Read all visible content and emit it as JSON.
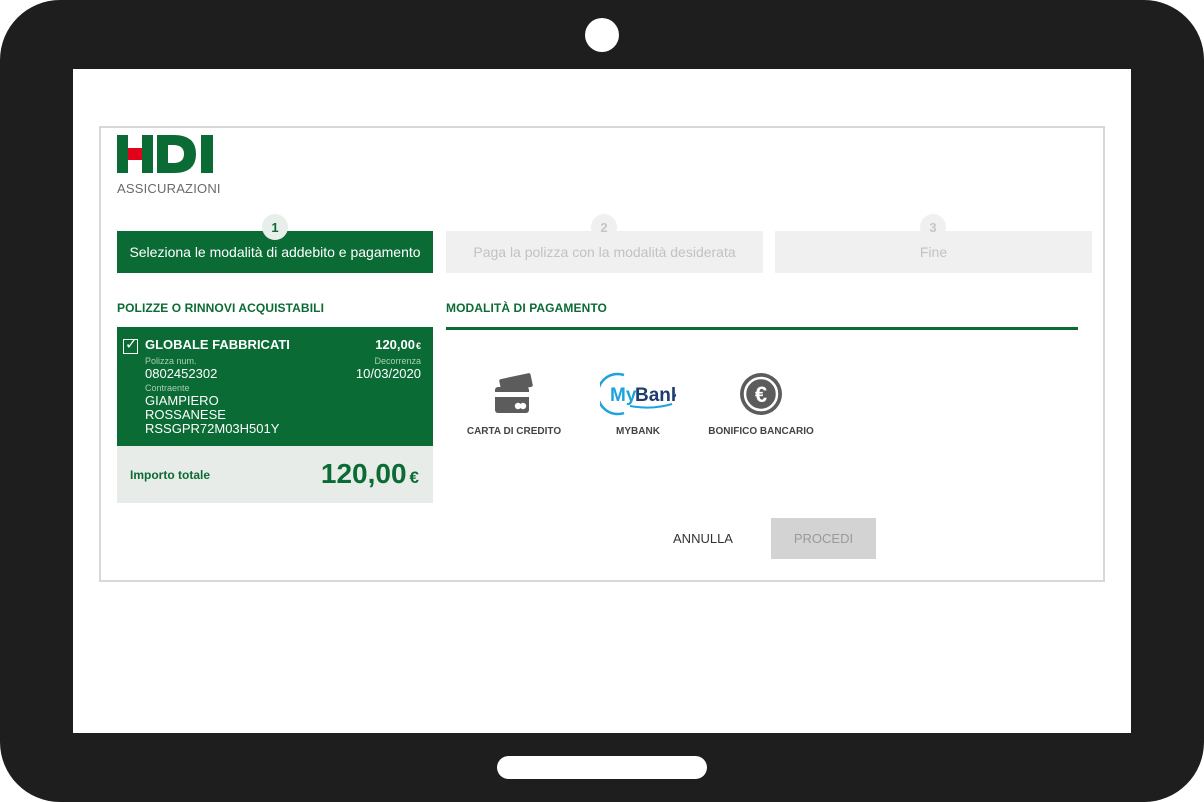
{
  "brand": {
    "logo_text": "HDI",
    "logo_subtitle": "ASSICURAZIONI",
    "colors": {
      "primary_green": "#0b6b34",
      "logo_red": "#e2001a",
      "inactive_gray": "#f0f0f0"
    }
  },
  "steps": [
    {
      "number": "1",
      "label": "Seleziona le modalità di addebito e pagamento",
      "active": true
    },
    {
      "number": "2",
      "label": "Paga la polizza con la modalità desiderata",
      "active": false
    },
    {
      "number": "3",
      "label": "Fine",
      "active": false
    }
  ],
  "policies_section": {
    "title": "POLIZZE O RINNOVI ACQUISTABILI",
    "policy": {
      "checked": true,
      "name": "GLOBALE FABBRICATI",
      "amount": "120,00",
      "currency": "€",
      "number_label": "Polizza num.",
      "number": "0802452302",
      "start_label": "Decorrenza",
      "start_date": "10/03/2020",
      "holder_label": "Contraente",
      "holder_first": "GIAMPIERO",
      "holder_last": "ROSSANESE",
      "tax_code": "RSSGPR72M03H501Y"
    },
    "total_label": "Importo totale",
    "total_amount": "120,00",
    "total_currency": "€"
  },
  "payment_section": {
    "title": "MODALITÀ DI PAGAMENTO",
    "methods": [
      {
        "label": "CARTA DI CREDITO",
        "icon": "credit-card-icon"
      },
      {
        "label": "MYBANK",
        "icon": "mybank-logo-icon",
        "logo_text_my": "My",
        "logo_text_bank": "Bank"
      },
      {
        "label": "BONIFICO BANCARIO",
        "icon": "euro-coin-icon",
        "symbol": "€"
      }
    ]
  },
  "actions": {
    "cancel_label": "ANNULLA",
    "proceed_label": "PROCEDI",
    "proceed_disabled": true
  }
}
